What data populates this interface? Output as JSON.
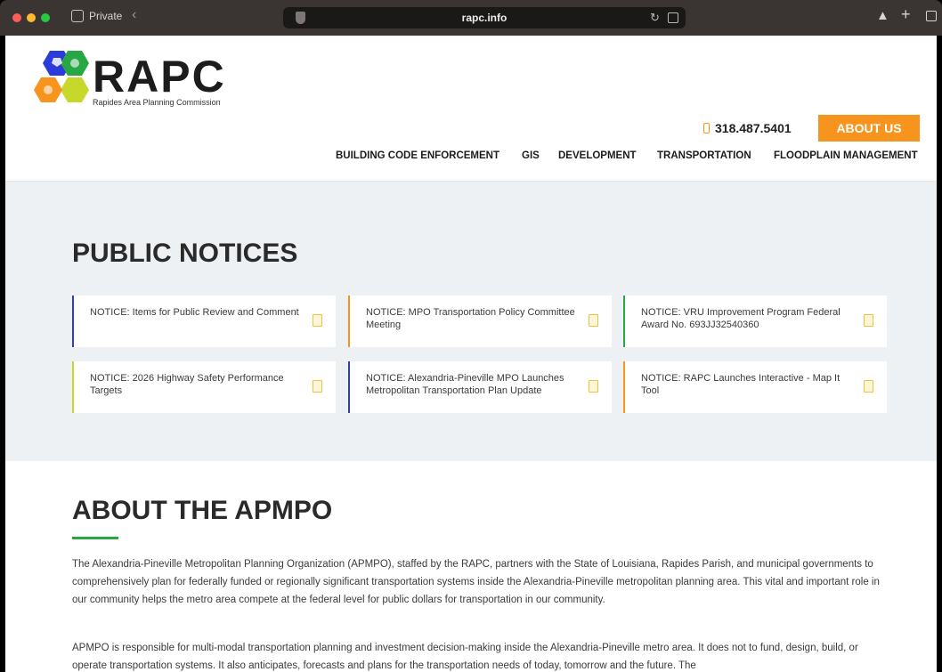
{
  "browser": {
    "private_label": "Private",
    "url": "rapc.info"
  },
  "header": {
    "logo_name": "RAPC",
    "logo_subtitle": "Rapides Area Planning Commission",
    "phone": "318.487.5401",
    "about_button": "ABOUT US",
    "nav": [
      "BUILDING CODE ENFORCEMENT",
      "GIS",
      "DEVELOPMENT",
      "TRANSPORTATION",
      "FLOODPLAIN MANAGEMENT"
    ]
  },
  "notices": {
    "title": "PUBLIC NOTICES",
    "items": [
      {
        "text": "NOTICE: Items for Public Review and Comment",
        "accent": "#2b3bdc"
      },
      {
        "text": "NOTICE: MPO Transportation Policy Committee Meeting",
        "accent": "#f7941d"
      },
      {
        "text": "NOTICE: VRU Improvement Program Federal Award No. 693JJ32540360",
        "accent": "#28a745"
      },
      {
        "text": "NOTICE: 2026 Highway Safety Performance Targets",
        "accent": "#c8d82a"
      },
      {
        "text": "NOTICE: Alexandria-Pineville MPO Launches Metropolitan Transportation Plan Update",
        "accent": "#2b3bdc"
      },
      {
        "text": "NOTICE: RAPC Launches Interactive - Map It Tool",
        "accent": "#f7941d"
      }
    ]
  },
  "about": {
    "title": "ABOUT THE APMPO",
    "paragraph1": "The Alexandria-Pineville Metropolitan Planning Organization (APMPO), staffed by the RAPC, partners with the State of Louisiana, Rapides Parish, and municipal governments to comprehensively plan for federally funded or regionally significant transportation systems inside the Alexandria-Pineville metropolitan planning area. This vital and important role in our community helps the metro area compete at the federal level for public dollars for transportation in our community.",
    "paragraph2": "APMPO is responsible for multi-modal transportation planning and investment decision-making inside the Alexandria-Pineville metro area. It does not to fund, design, build, or operate transportation systems. It also anticipates, forecasts and plans for the transportation needs of today, tomorrow and the future. The"
  },
  "colors": {
    "accent_orange": "#f7941d",
    "accent_blue": "#2b3bdc",
    "accent_green": "#28a745",
    "accent_lime": "#c8d82a"
  }
}
